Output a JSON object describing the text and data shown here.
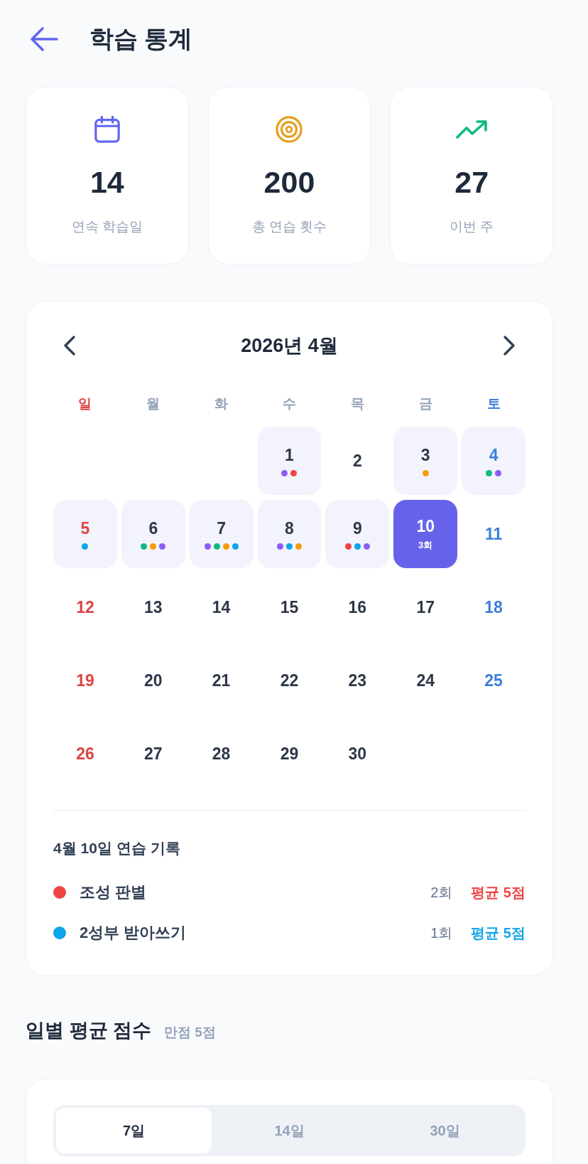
{
  "header": {
    "title": "학습 통계"
  },
  "stats": [
    {
      "kind": "calendar",
      "value": "14",
      "label": "연속 학습일"
    },
    {
      "kind": "target",
      "value": "200",
      "label": "총 연습 횟수"
    },
    {
      "kind": "trend",
      "value": "27",
      "label": "이번 주"
    }
  ],
  "calendar": {
    "month": "2026년 4월",
    "weekdays": [
      "일",
      "월",
      "화",
      "수",
      "목",
      "금",
      "토"
    ],
    "weeks": [
      {
        "days": [
          {
            "label": "1",
            "practiced": true,
            "selected": false,
            "dots": [
              {
                "color": "#8b5cf6"
              },
              {
                "color": "#ef4444"
              }
            ]
          },
          {
            "label": "2",
            "practiced": false,
            "selected": false
          },
          {
            "label": "3",
            "practiced": true,
            "selected": false,
            "dots": [
              {
                "color": "#f59e0b"
              }
            ]
          },
          {
            "label": "4",
            "practiced": true,
            "selected": false,
            "dots": [
              {
                "color": "#10b981"
              },
              {
                "color": "#8b5cf6"
              }
            ]
          }
        ]
      },
      {
        "days": [
          {
            "label": "5",
            "practiced": true,
            "selected": false,
            "dots": [
              {
                "color": "#0ea5e9"
              }
            ]
          },
          {
            "label": "6",
            "practiced": true,
            "selected": false,
            "dots": [
              {
                "color": "#10b981"
              },
              {
                "color": "#f59e0b"
              },
              {
                "color": "#8b5cf6"
              }
            ]
          },
          {
            "label": "7",
            "practiced": true,
            "selected": false,
            "dots": [
              {
                "color": "#8b5cf6"
              },
              {
                "color": "#10b981"
              },
              {
                "color": "#f59e0b"
              },
              {
                "color": "#0ea5e9"
              }
            ]
          },
          {
            "label": "8",
            "practiced": true,
            "selected": false,
            "dots": [
              {
                "color": "#8b5cf6"
              },
              {
                "color": "#0ea5e9"
              },
              {
                "color": "#f59e0b"
              }
            ]
          },
          {
            "label": "9",
            "practiced": true,
            "selected": false,
            "dots": [
              {
                "color": "#ef4444"
              },
              {
                "color": "#0ea5e9"
              },
              {
                "color": "#8b5cf6"
              }
            ]
          },
          {
            "label": "10",
            "practiced": true,
            "selected": true,
            "count": "3회"
          },
          {
            "label": "11",
            "practiced": false,
            "selected": false
          }
        ]
      },
      {
        "days": [
          {
            "label": "12",
            "practiced": false,
            "selected": false
          },
          {
            "label": "13",
            "practiced": false,
            "selected": false
          },
          {
            "label": "14",
            "practiced": false,
            "selected": false
          },
          {
            "label": "15",
            "practiced": false,
            "selected": false
          },
          {
            "label": "16",
            "practiced": false,
            "selected": false
          },
          {
            "label": "17",
            "practiced": false,
            "selected": false
          },
          {
            "label": "18",
            "practiced": false,
            "selected": false
          }
        ]
      },
      {
        "days": [
          {
            "label": "19",
            "practiced": false,
            "selected": false
          },
          {
            "label": "20",
            "practiced": false,
            "selected": false
          },
          {
            "label": "21",
            "practiced": false,
            "selected": false
          },
          {
            "label": "22",
            "practiced": false,
            "selected": false
          },
          {
            "label": "23",
            "practiced": false,
            "selected": false
          },
          {
            "label": "24",
            "practiced": false,
            "selected": false
          },
          {
            "label": "25",
            "practiced": false,
            "selected": false
          }
        ]
      },
      {
        "days": [
          {
            "label": "26",
            "practiced": false,
            "selected": false
          },
          {
            "label": "27",
            "practiced": false,
            "selected": false
          },
          {
            "label": "28",
            "practiced": false,
            "selected": false
          },
          {
            "label": "29",
            "practiced": false,
            "selected": false
          },
          {
            "label": "30",
            "practiced": false,
            "selected": false
          }
        ]
      }
    ],
    "records": {
      "title": "4월 10일 연습 기록",
      "items": [
        {
          "color": "#ef4444",
          "name": "조성 판별",
          "count": "2회",
          "average": "평균 5점"
        },
        {
          "color": "#0ea5e9",
          "name": "2성부 받아쓰기",
          "count": "1회",
          "average": "평균 5점"
        }
      ]
    }
  },
  "daily_scores": {
    "title": "일별 평균 점수",
    "subtitle": "만점 5점",
    "tabs": [
      {
        "label": "7일",
        "selected": true
      },
      {
        "label": "14일",
        "selected": false
      },
      {
        "label": "30일",
        "selected": false
      }
    ]
  }
}
